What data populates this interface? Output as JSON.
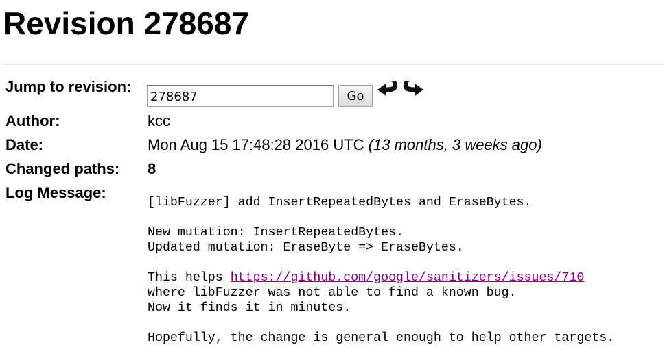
{
  "page": {
    "title": "Revision 278687"
  },
  "jump": {
    "label": "Jump to revision:",
    "input_value": "278687",
    "go_label": "Go",
    "prev_icon": "previous-revision-arrow",
    "next_icon": "next-revision-arrow"
  },
  "author": {
    "label": "Author:",
    "value": "kcc"
  },
  "date": {
    "label": "Date:",
    "value": "Mon Aug 15 17:48:28 2016 UTC",
    "relative": "(13 months, 3 weeks ago)"
  },
  "changed_paths": {
    "label": "Changed paths:",
    "value": "8"
  },
  "log": {
    "label": "Log Message:",
    "line1": "[libFuzzer] add InsertRepeatedBytes and EraseBytes.",
    "line2": "New mutation: InsertRepeatedBytes.",
    "line3": "Updated mutation: EraseByte => EraseBytes.",
    "line4_prefix": "This helps ",
    "link": "https://github.com/google/sanitizers/issues/710",
    "line5": "where libFuzzer was not able to find a known bug.",
    "line6": "Now it finds it in minutes.",
    "line7": "Hopefully, the change is general enough to help other targets."
  },
  "colors": {
    "link_visited": "#800080",
    "text": "#000000",
    "background": "#ffffff"
  }
}
